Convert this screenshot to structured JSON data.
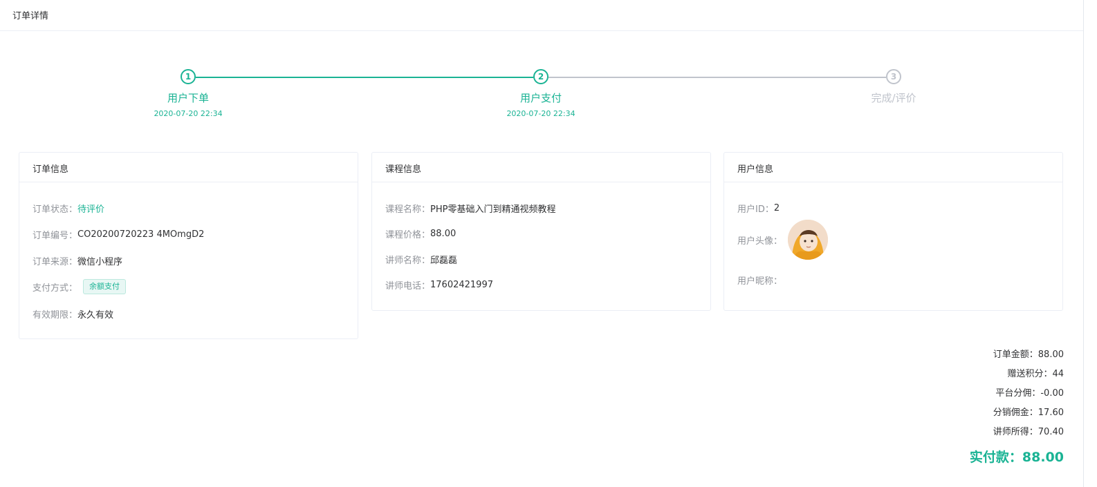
{
  "page": {
    "title": "订单详情"
  },
  "steps": [
    {
      "num": "1",
      "title": "用户下单",
      "time": "2020-07-20 22:34",
      "status": "done"
    },
    {
      "num": "2",
      "title": "用户支付",
      "time": "2020-07-20 22:34",
      "status": "done"
    },
    {
      "num": "3",
      "title": "完成/评价",
      "time": "",
      "status": "wait"
    }
  ],
  "order_card": {
    "title": "订单信息",
    "status_label": "订单状态：",
    "status_value": "待评价",
    "number_label": "订单编号：",
    "number_value": "CO20200720223 4MOmgD2",
    "source_label": "订单来源：",
    "source_value": "微信小程序",
    "payment_label": "支付方式：",
    "payment_value": "余额支付",
    "validity_label": "有效期限：",
    "validity_value": "永久有效"
  },
  "course_card": {
    "title": "课程信息",
    "name_label": "课程名称：",
    "name_value": "PHP零基础入门到精通视频教程",
    "price_label": "课程价格：",
    "price_value": "88.00",
    "teacher_label": "讲师名称：",
    "teacher_value": "邱磊磊",
    "phone_label": "讲师电话：",
    "phone_value": "17602421997"
  },
  "user_card": {
    "title": "用户信息",
    "id_label": "用户ID：",
    "id_value": "2",
    "avatar_label": "用户头像：",
    "nickname_label": "用户昵称：",
    "nickname_value": ""
  },
  "summary": {
    "order_amount": "订单金额：88.00",
    "bonus_points": "赠送积分：44",
    "platform_commission": "平台分佣：-0.00",
    "distribution_commission": "分销佣金：17.60",
    "teacher_income": "讲师所得：70.40",
    "paid_total": "实付款：88.00"
  },
  "colors": {
    "accent": "#1ab394",
    "muted": "#c0c4cc",
    "label": "#909399",
    "text": "#303133"
  }
}
